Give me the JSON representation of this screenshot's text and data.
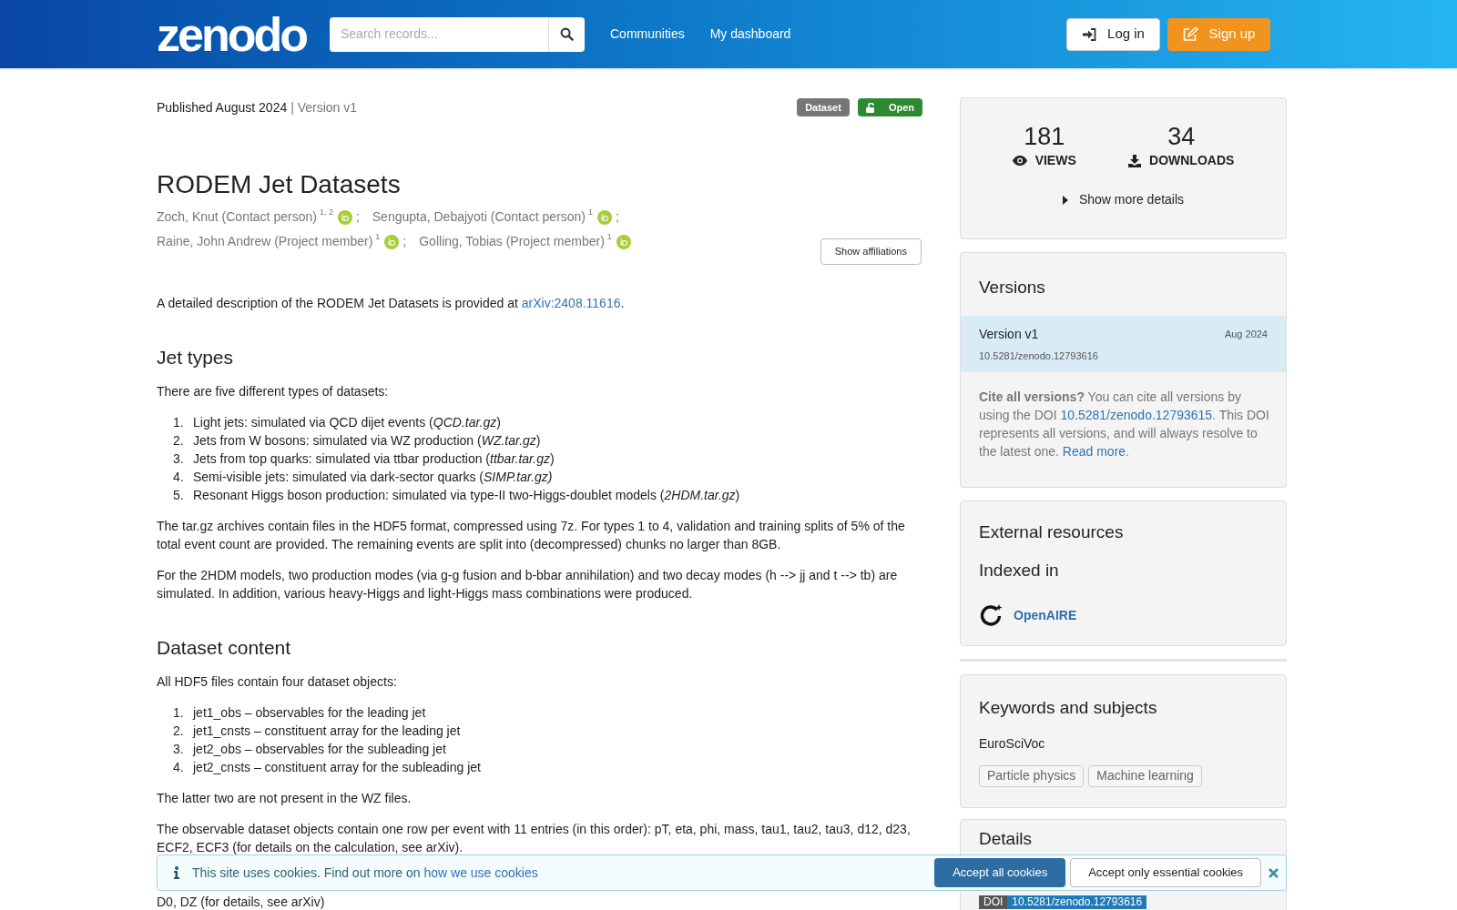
{
  "header": {
    "logo": "zenodo",
    "search": {
      "placeholder": "Search records..."
    },
    "nav": [
      "Communities",
      "My dashboard"
    ],
    "login": "Log in",
    "signup": "Sign up"
  },
  "record": {
    "published": "Published August 2024",
    "version": "| Version v1",
    "badges": [
      {
        "kind": "type",
        "label": "Dataset"
      },
      {
        "kind": "access",
        "label": "Open"
      }
    ],
    "title": "RODEM Jet Datasets",
    "creators": [
      [
        {
          "name": "Zoch, Knut (Contact person)",
          "sup": "1, 2",
          "sep": ";"
        },
        {
          "name": "Sengupta, Debajyoti (Contact person)",
          "sup": "1",
          "sep": ";"
        }
      ],
      [
        {
          "name": "Raine, John Andrew (Project member)",
          "sup": "1",
          "sep": ";"
        },
        {
          "name": "Golling, Tobias (Project member)",
          "sup": "1"
        }
      ]
    ],
    "show_affiliations": "Show affiliations",
    "body": [
      {
        "kind": "paragraph",
        "parts": [
          {
            "kind": "text",
            "text": "A detailed description of the RODEM Jet Datasets is provided at "
          },
          {
            "kind": "link",
            "text": "arXiv:2408.11616"
          },
          {
            "kind": "text",
            "text": "."
          }
        ]
      },
      {
        "kind": "heading",
        "text": "Jet types"
      },
      {
        "kind": "paragraph",
        "parts": [
          {
            "kind": "text",
            "text": "There are five different types of datasets:"
          }
        ]
      },
      {
        "kind": "list",
        "items": [
          {
            "number": "1.",
            "text": "Light jets: simulated via QCD dijet events (*QCD.tar.gz*)"
          },
          {
            "number": "2.",
            "text": "Jets from W bosons: simulated via WZ production (*WZ.tar.gz*)"
          },
          {
            "number": "3.",
            "text": "Jets from top quarks: simulated via ttbar production (*ttbar.tar.gz*)"
          },
          {
            "number": "4.",
            "text": "Semi-visible jets: simulated via dark-sector quarks (*SIMP.tar.gz)*"
          },
          {
            "number": "5.",
            "text": "Resonant Higgs boson production: simulated via type-II two-Higgs-doublet models (*2HDM.tar.gz*)"
          }
        ]
      },
      {
        "kind": "paragraph",
        "parts": [
          {
            "kind": "text",
            "text": "The tar.gz archives contain files in the HDF5 format, compressed using 7z. For types 1 to 4, validation and training splits of 5% of the total event count are provided. The remaining events are split into (decompressed) chunks no larger than 8GB."
          }
        ]
      },
      {
        "kind": "paragraph",
        "parts": [
          {
            "kind": "text",
            "text": "For the 2HDM models, two production modes (via g-g fusion and b-bbar annihilation) and two decay modes (h --> jj and t --> tb) are simulated. In addition, various heavy-Higgs and light-Higgs mass combinations were produced."
          }
        ]
      },
      {
        "kind": "heading",
        "text": "Dataset content"
      },
      {
        "kind": "paragraph",
        "parts": [
          {
            "kind": "text",
            "text": "All HDF5 files contain four dataset objects:"
          }
        ]
      },
      {
        "kind": "list",
        "items": [
          {
            "number": "1.",
            "text": "jet1_obs – observables for the leading jet"
          },
          {
            "number": "2.",
            "text": "jet1_cnsts – constituent array for the leading jet"
          },
          {
            "number": "3.",
            "text": "jet2_obs – observables for the subleading jet"
          },
          {
            "number": "4.",
            "text": "jet2_cnsts – constituent array for the subleading jet"
          }
        ]
      },
      {
        "kind": "paragraph",
        "parts": [
          {
            "kind": "text",
            "text": "The latter two are not present in the WZ files."
          }
        ]
      },
      {
        "kind": "paragraph",
        "parts": [
          {
            "kind": "text",
            "text": "The observable dataset objects contain one row per event with 11 entries (in this order): pT, eta, phi, mass, tau1, tau2, tau3, d12, d23, ECF2, ECF3 (for details on the calculation, see arXiv)."
          }
        ]
      },
      {
        "kind": "tail",
        "parts": [
          {
            "kind": "text",
            "text": "D0, DZ (for details, see arXiv)"
          }
        ]
      }
    ]
  },
  "sidebar": {
    "stats": [
      {
        "kind": "views",
        "value": "181",
        "label": "VIEWS"
      },
      {
        "kind": "downloads",
        "value": "34",
        "label": "DOWNLOADS"
      }
    ],
    "more_details": "Show more details",
    "versions": {
      "title": "Versions",
      "items": [
        {
          "name": "Version v1",
          "date": "Aug 2024",
          "doi": "10.5281/zenodo.12793616",
          "selected": true
        }
      ],
      "cite": "**Cite all versions?** You can cite all versions by using the DOI ",
      "cite_doi": "10.5281/zenodo.12793615",
      "cite_rest": ". This DOI represents all versions, and will always resolve to the latest one. ",
      "read_more": "Read more",
      "cite_end": "."
    },
    "external": {
      "title": "External resources",
      "subtitle": "Indexed in",
      "link": "OpenAIRE"
    },
    "keywords": {
      "title": "Keywords and subjects",
      "scheme": "EuroSciVoc",
      "tags": [
        "Particle physics",
        "Machine learning"
      ]
    },
    "details": {
      "title": "Details",
      "doi_label": "DOI",
      "doi": "10.5281/zenodo.12793616"
    }
  },
  "cookie": {
    "text": "This site uses cookies. Find out more on ",
    "link": "how we use cookies",
    "accept_all": "Accept all cookies",
    "accept_essential": "Accept only essential cookies"
  }
}
